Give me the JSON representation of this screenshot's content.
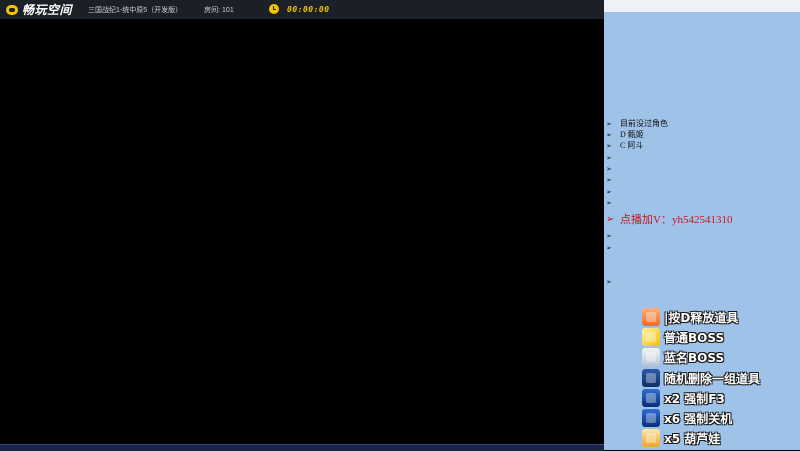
{
  "titlebar": {
    "logo_text": "畅玩空间",
    "game_title": "三国战纪1-统中原5（开发版）",
    "room": "房间: 101",
    "timer": "00:00:00"
  },
  "right_panel": {
    "list": [
      {
        "text": "目前没过角色"
      },
      {
        "text": "D 甄姬"
      },
      {
        "text": "C 阿斗"
      },
      {
        "text": ""
      },
      {
        "text": ""
      },
      {
        "text": ""
      },
      {
        "text": ""
      },
      {
        "text": ""
      },
      {
        "text": "点播加V：yh542541310",
        "highlight": true
      },
      {
        "text": ""
      },
      {
        "text": ""
      },
      {
        "text": ""
      }
    ],
    "gifts": [
      {
        "label": "|按D释放道具",
        "icon": "gift-box-icon"
      },
      {
        "label": "普通BOSS",
        "icon": "gold-bar-icon"
      },
      {
        "label": "蓝名BOSS",
        "icon": "wing-icon"
      },
      {
        "label": "随机删除一组道具",
        "icon": "treasure-box-icon"
      },
      {
        "label": "x2 强制F3",
        "icon": "rocket-icon"
      },
      {
        "label": "x6 强制关机",
        "icon": "rocket-icon"
      },
      {
        "label": "x5 葫芦娃",
        "icon": "gourd-icon"
      }
    ]
  },
  "colors": {
    "panel_bg": "#9fc3e8",
    "accent_yellow": "#f2c500",
    "highlight_red": "#c5161d"
  }
}
